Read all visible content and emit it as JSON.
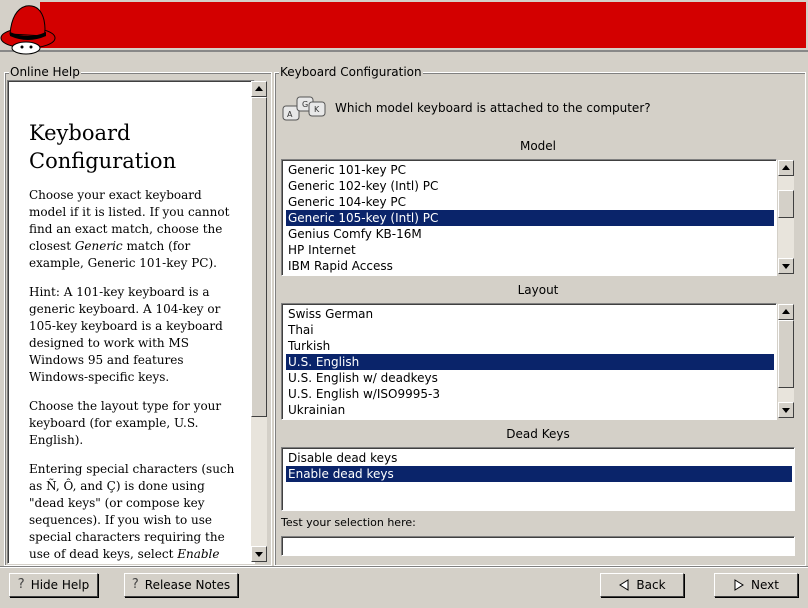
{
  "help": {
    "legend": "Online Help",
    "title_line1": "Keyboard",
    "title_line2": "Configuration",
    "p1_a": "Choose your exact keyboard model if it is listed. If you cannot find an exact match, choose the closest ",
    "p1_em": "Generic",
    "p1_b": " match (for example, Generic 101-key PC).",
    "p2": "Hint: A 101-key keyboard is a generic keyboard. A 104-key or 105-key keyboard is a keyboard designed to work with MS Windows 95 and features Windows-specific keys.",
    "p3": "Choose the layout type for your keyboard (for example, U.S. English).",
    "p4_a": "Entering special characters (such as Ñ, Ô, and Ç) is done using \"dead keys\" (or compose key sequences). If you wish to use special characters requiring the use of dead keys, select ",
    "p4_em": "Enable"
  },
  "config": {
    "legend": "Keyboard Configuration",
    "question": "Which model keyboard is attached to the computer?",
    "model_label": "Model",
    "models": [
      "Generic 101-key PC",
      "Generic 102-key (Intl) PC",
      "Generic 104-key PC",
      "Generic 105-key (Intl) PC",
      "Genius Comfy KB-16M",
      "HP Internet",
      "IBM Rapid Access"
    ],
    "layout_label": "Layout",
    "layouts": [
      "Swiss German",
      "Thai",
      "Turkish",
      "U.S. English",
      "U.S. English w/ deadkeys",
      "U.S. English w/ISO9995-3",
      "Ukrainian"
    ],
    "deadkeys_label": "Dead Keys",
    "deadkeys": [
      "Disable dead keys",
      "Enable dead keys"
    ],
    "test_label": "Test your selection here:",
    "test_value": ""
  },
  "buttons": {
    "hide_help": "Hide Help",
    "release_notes": "Release Notes",
    "back": "Back",
    "next": "Next"
  },
  "colors": {
    "banner": "#d30000",
    "selection": "#0a246a"
  }
}
